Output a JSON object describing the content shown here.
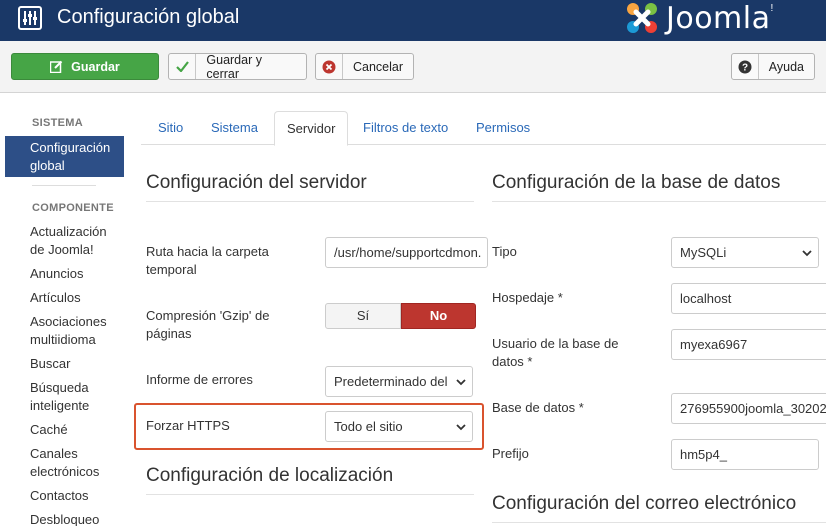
{
  "header": {
    "title": "Configuración global",
    "brand": "Joomla!",
    "brand_text": "Joomla",
    "brand_suffix": "!"
  },
  "toolbar": {
    "save": "Guardar",
    "save_close": "Guardar y cerrar",
    "cancel": "Cancelar",
    "help": "Ayuda"
  },
  "sidebar": {
    "heading_system": "SISTEMA",
    "active_item_line1": "Configuración",
    "active_item_line2": "global",
    "heading_component": "COMPONENTE",
    "items": [
      [
        "Actualización",
        "de Joomla!"
      ],
      [
        "Anuncios"
      ],
      [
        "Artículos"
      ],
      [
        "Asociaciones",
        "multiidioma"
      ],
      [
        "Buscar"
      ],
      [
        "Búsqueda",
        "inteligente"
      ],
      [
        "Caché"
      ],
      [
        "Canales",
        "electrónicos"
      ],
      [
        "Contactos"
      ],
      [
        "Desbloqueo"
      ]
    ]
  },
  "tabs": [
    "Sitio",
    "Sistema",
    "Servidor",
    "Filtros de texto",
    "Permisos"
  ],
  "server": {
    "title": "Configuración del servidor",
    "temp_label_1": "Ruta hacia la carpeta",
    "temp_label_2": "temporal",
    "temp_value": "/usr/home/supportcdmon.",
    "gzip_label_1": "Compresión 'Gzip' de",
    "gzip_label_2": "páginas",
    "gzip_yes": "Sí",
    "gzip_no": "No",
    "error_label": "Informe de errores",
    "error_value": "Predeterminado del",
    "https_label": "Forzar HTTPS",
    "https_value": "Todo el sitio"
  },
  "locale": {
    "title": "Configuración de localización"
  },
  "database": {
    "title": "Configuración de la base de datos",
    "type_label": "Tipo",
    "type_value": "MySQLi",
    "host_label": "Hospedaje *",
    "host_value": "localhost",
    "user_label_1": "Usuario de la base de",
    "user_label_2": "datos *",
    "user_value": "myexa6967",
    "db_label": "Base de datos *",
    "db_value": "276955900joomla_30202",
    "prefix_label": "Prefijo",
    "prefix_value": "hm5p4_"
  },
  "mail": {
    "title": "Configuración del correo electrónico"
  },
  "colors": {
    "header": "#1a3867",
    "save": "#46a546",
    "no": "#bd362f",
    "active_sidebar": "#2d4f87",
    "highlight": "#d9532e",
    "link": "#2a69b8"
  }
}
